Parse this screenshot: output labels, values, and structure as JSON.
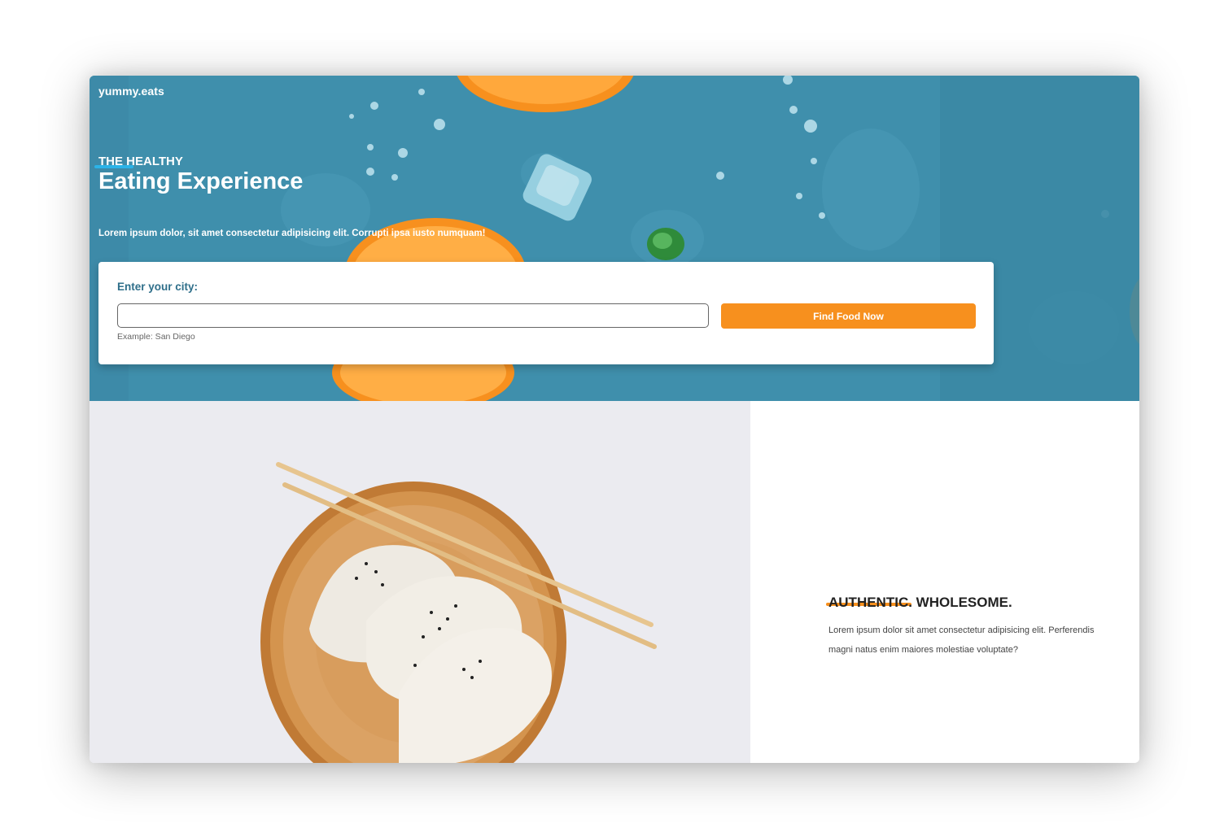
{
  "brand": {
    "logo": "yummy.eats"
  },
  "hero": {
    "eyebrow": "THE HEALTHY",
    "headline": "Eating Experience",
    "subline": "Lorem ipsum dolor, sit amet consectetur adipisicing elit. Corrupti ipsa iusto numquam!"
  },
  "search": {
    "label": "Enter your city:",
    "input_value": "",
    "hint": "Example: San Diego",
    "button_label": "Find Food Now"
  },
  "feature": {
    "title": "AUTHENTIC. WHOLESOME.",
    "body_line1": "Lorem ipsum dolor sit amet consectetur adipisicing elit. Perferendis",
    "body_line2": "magni natus enim maiores molestiae voluptate?"
  },
  "colors": {
    "hero_background": "#3f8fac",
    "accent_orange": "#f7901e",
    "accent_blue": "#2bb3e8",
    "label_teal": "#2f6f8a"
  },
  "icons": {
    "hero_image": "orange-slices-water-drops-image",
    "food_image": "dumplings-plate-chopsticks-image"
  }
}
